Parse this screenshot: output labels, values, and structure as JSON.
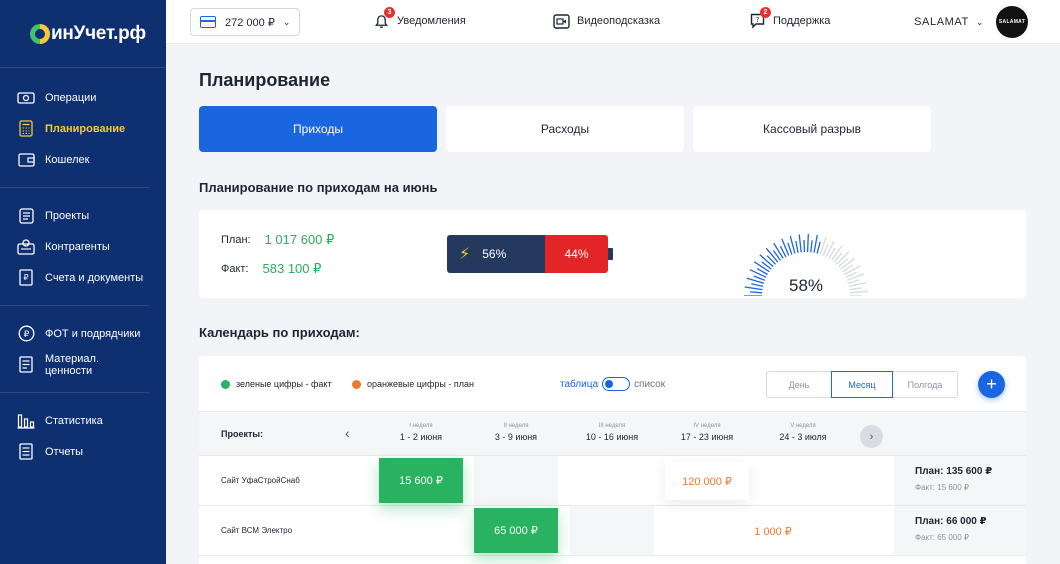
{
  "sidebar": {
    "logo": "инУчет.рф",
    "groups": [
      [
        {
          "label": "Операции",
          "icon": "cash-icon",
          "active": false
        },
        {
          "label": "Планирование",
          "icon": "calculator-icon",
          "active": true
        },
        {
          "label": "Кошелек",
          "icon": "wallet-icon",
          "active": false
        }
      ],
      [
        {
          "label": "Проекты",
          "icon": "projects-icon",
          "active": false
        },
        {
          "label": "Контрагенты",
          "icon": "contacts-icon",
          "active": false
        },
        {
          "label": "Счета и документы",
          "icon": "invoice-icon",
          "active": false
        }
      ],
      [
        {
          "label": "ФОТ и подрядчики",
          "icon": "ruble-icon",
          "active": false
        },
        {
          "label": "Материал. ценности",
          "icon": "materials-icon",
          "active": false
        }
      ],
      [
        {
          "label": "Статистика",
          "icon": "stats-icon",
          "active": false
        },
        {
          "label": "Отчеты",
          "icon": "reports-icon",
          "active": false
        }
      ]
    ]
  },
  "topbar": {
    "balance": "272 000 ₽",
    "notifications": {
      "label": "Уведомления",
      "count": "3"
    },
    "video_hint": "Видеоподсказка",
    "support": {
      "label": "Поддержка",
      "count": "2"
    },
    "user": "SALAMAT",
    "avatar_text": "SALAMAT"
  },
  "page": {
    "title": "Планирование",
    "tabs": [
      {
        "label": "Приходы",
        "active": true
      },
      {
        "label": "Расходы",
        "active": false
      },
      {
        "label": "Кассовый разрыв",
        "active": false
      }
    ]
  },
  "plan_summary": {
    "title": "Планирование по приходам на июнь",
    "plan_label": "План:",
    "plan_value": "1 017 600 ₽",
    "fact_label": "Факт:",
    "fact_value": "583 100 ₽",
    "fact_percent": "56%",
    "fact_fraction": 0.56,
    "remaining_percent": "44%",
    "gauge_value": "58%",
    "gauge_fraction": 0.58
  },
  "calendar": {
    "title": "Календарь по приходам:",
    "legend_fact": "зеленые цифры - факт",
    "legend_plan": "оранжевые цифры - план",
    "view_table": "таблица",
    "view_list": "список",
    "periods": [
      {
        "label": "День",
        "active": false
      },
      {
        "label": "Месяц",
        "active": true
      },
      {
        "label": "Полгода",
        "active": false
      }
    ],
    "add_label": "+",
    "projects_header": "Проекты:",
    "weeks": [
      {
        "name": "I неделя",
        "dates": "1 - 2 июня"
      },
      {
        "name": "II неделя",
        "dates": "3 - 9 июня"
      },
      {
        "name": "III неделя",
        "dates": "10 - 16 июня"
      },
      {
        "name": "IV неделя",
        "dates": "17 - 23 июня"
      },
      {
        "name": "V неделя",
        "dates": "24 - 3 июля"
      }
    ],
    "rows": [
      {
        "project": "Сайт УфаСтройСнаб",
        "cells": [
          {
            "week": 0,
            "value": "15 600 ₽",
            "kind": "fact"
          },
          {
            "week": 3,
            "value": "120 000 ₽",
            "kind": "plan"
          }
        ],
        "plan": "План: 135 600 ₽",
        "plan_label": "План:",
        "plan_value": "135 600 ₽",
        "fact": "Факт: 15 600 ₽"
      },
      {
        "project": "Сайт ВСМ Электро",
        "cells": [
          {
            "week": 1,
            "value": "65 000 ₽",
            "kind": "fact"
          },
          {
            "week": 4,
            "value": "1 000 ₽",
            "kind": "plan"
          }
        ],
        "plan_label": "План:",
        "plan_value": "66 000 ₽",
        "fact": "Факт: 65 000 ₽"
      }
    ]
  },
  "colors": {
    "sidebar": "#0e2f70",
    "accent": "#1a66e0",
    "fact_green": "#29b25f",
    "plan_orange": "#f07a2c",
    "battery_dark": "#24395e",
    "battery_red": "#e22526",
    "active_nav": "#f7c932"
  }
}
